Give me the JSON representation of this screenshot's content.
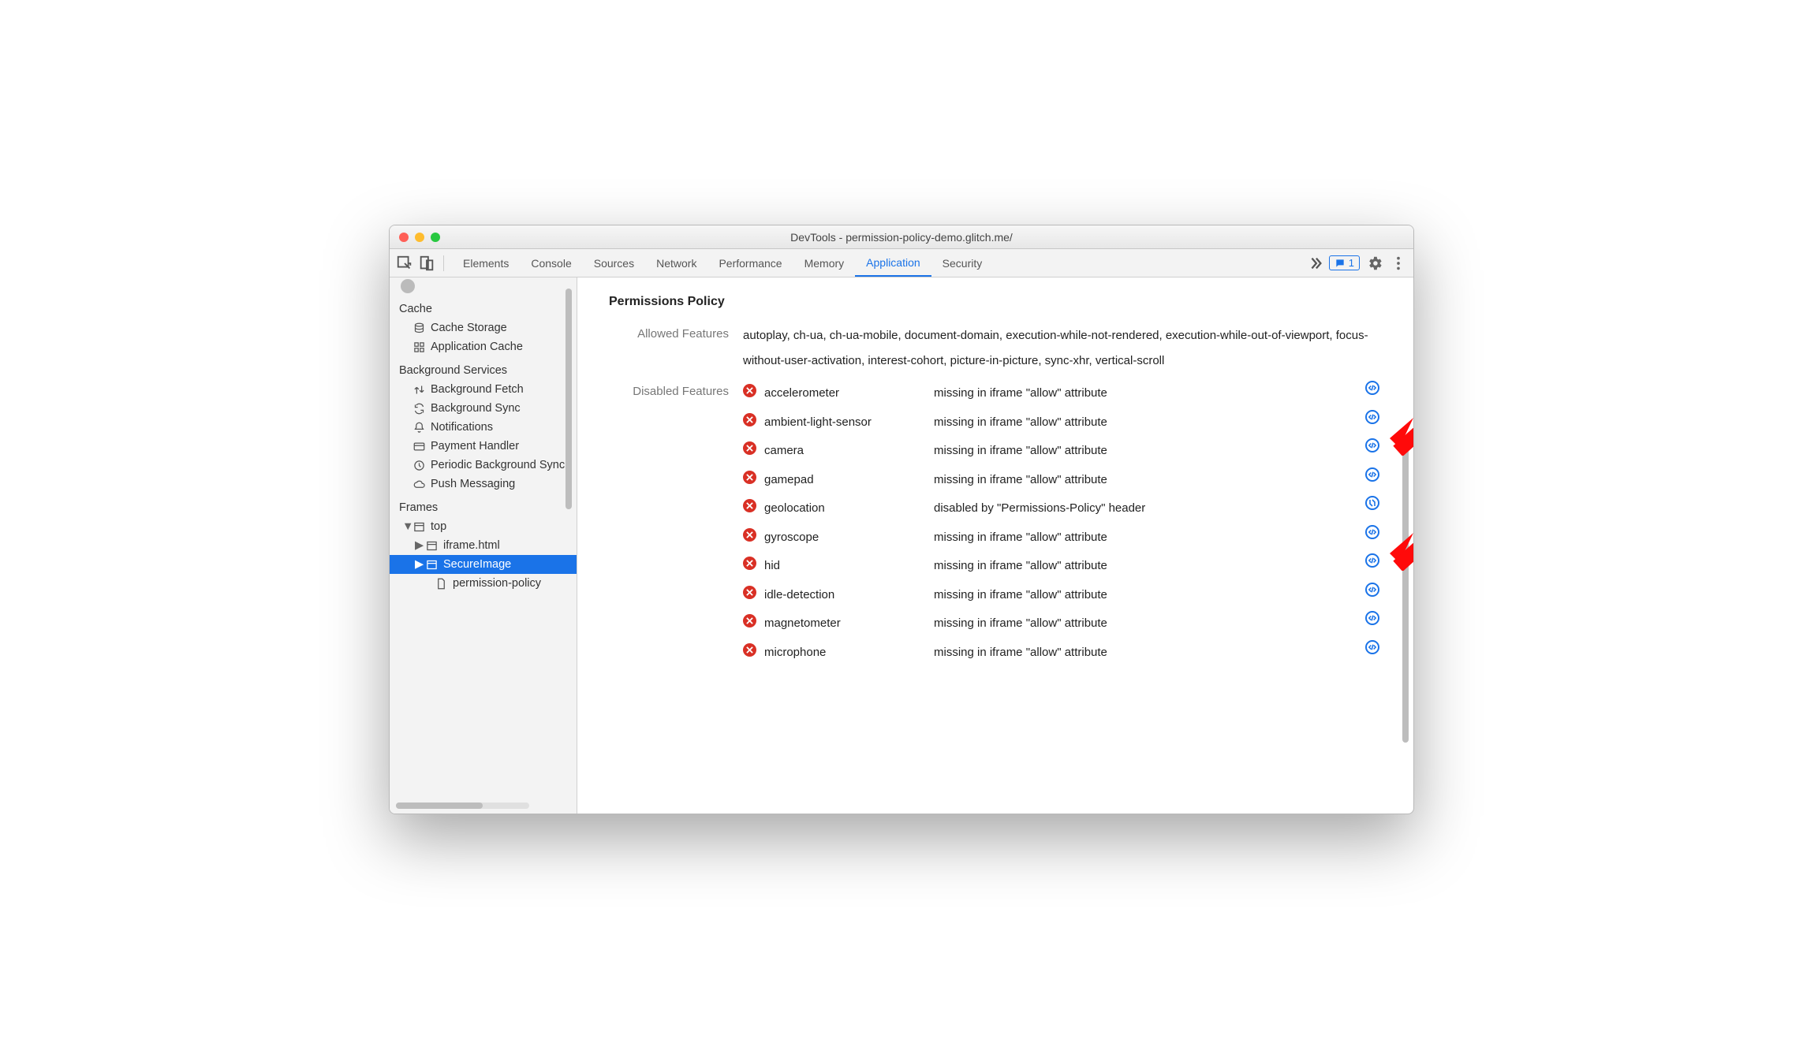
{
  "window": {
    "title": "DevTools - permission-policy-demo.glitch.me/"
  },
  "toolbar": {
    "tabs": [
      "Elements",
      "Console",
      "Sources",
      "Network",
      "Performance",
      "Memory",
      "Application",
      "Security"
    ],
    "active_tab": "Application",
    "issues_count": "1"
  },
  "sidebar": {
    "cache": {
      "title": "Cache",
      "items": [
        "Cache Storage",
        "Application Cache"
      ]
    },
    "background": {
      "title": "Background Services",
      "items": [
        "Background Fetch",
        "Background Sync",
        "Notifications",
        "Payment Handler",
        "Periodic Background Sync",
        "Push Messaging"
      ]
    },
    "frames": {
      "title": "Frames",
      "top": "top",
      "children": [
        {
          "label": "iframe.html",
          "selected": false
        },
        {
          "label": "SecureImage",
          "selected": true
        },
        {
          "label": "permission-policy",
          "selected": false,
          "leaf": true
        }
      ]
    }
  },
  "main": {
    "heading": "Permissions Policy",
    "allowed_label": "Allowed Features",
    "allowed_value": "autoplay, ch-ua, ch-ua-mobile, document-domain, execution-while-not-rendered, execution-while-out-of-viewport, focus-without-user-activation, interest-cohort, picture-in-picture, sync-xhr, vertical-scroll",
    "disabled_label": "Disabled Features",
    "disabled": [
      {
        "name": "accelerometer",
        "reason": "missing in iframe \"allow\" attribute",
        "icon": "code"
      },
      {
        "name": "ambient-light-sensor",
        "reason": "missing in iframe \"allow\" attribute",
        "icon": "code"
      },
      {
        "name": "camera",
        "reason": "missing in iframe \"allow\" attribute",
        "icon": "code"
      },
      {
        "name": "gamepad",
        "reason": "missing in iframe \"allow\" attribute",
        "icon": "code"
      },
      {
        "name": "geolocation",
        "reason": "disabled by \"Permissions-Policy\" header",
        "icon": "net"
      },
      {
        "name": "gyroscope",
        "reason": "missing in iframe \"allow\" attribute",
        "icon": "code"
      },
      {
        "name": "hid",
        "reason": "missing in iframe \"allow\" attribute",
        "icon": "code"
      },
      {
        "name": "idle-detection",
        "reason": "missing in iframe \"allow\" attribute",
        "icon": "code"
      },
      {
        "name": "magnetometer",
        "reason": "missing in iframe \"allow\" attribute",
        "icon": "code"
      },
      {
        "name": "microphone",
        "reason": "missing in iframe \"allow\" attribute",
        "icon": "code"
      }
    ]
  }
}
